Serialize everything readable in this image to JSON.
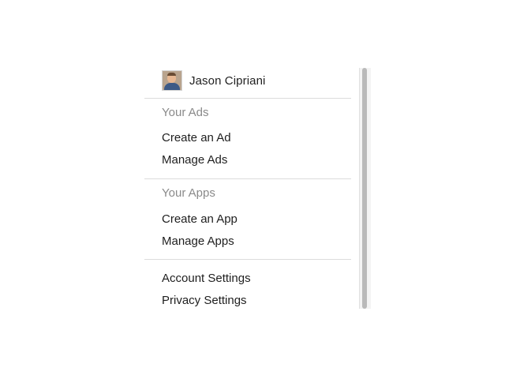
{
  "profile": {
    "name": "Jason Cipriani"
  },
  "ads": {
    "title": "Your Ads",
    "items": [
      "Create an Ad",
      "Manage Ads"
    ]
  },
  "apps": {
    "title": "Your Apps",
    "items": [
      "Create an App",
      "Manage Apps"
    ]
  },
  "settings": {
    "items": [
      "Account Settings",
      "Privacy Settings"
    ]
  },
  "colors": {
    "text": "#1e1e1e",
    "section_title": "#8a8a8a",
    "divider": "#dcdcdc",
    "scrollbar_thumb": "#b9b9b9"
  }
}
